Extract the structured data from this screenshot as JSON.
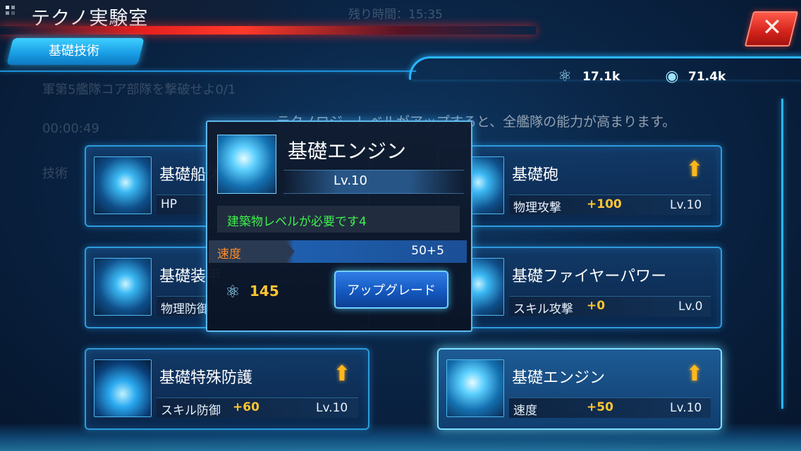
{
  "header": {
    "title": "テクノ実験室",
    "timer_ghost": "残り時間：15:35",
    "close_icon": "close-x-icon"
  },
  "tabs": [
    {
      "label": "基礎技術",
      "active": true
    }
  ],
  "resources": [
    {
      "icon": "atom-icon",
      "value": "17.1k"
    },
    {
      "icon": "robot-head-icon",
      "value": "71.4k"
    }
  ],
  "background_text": {
    "mission": "軍第5艦隊コア部隊を撃破せよ0/1",
    "mission_timer": "00:00:49",
    "tech_label": "技術",
    "info": "テクノロジーレベルがアップすると、全艦隊の能力が高まります。"
  },
  "cards": [
    {
      "name": "基礎船体",
      "stat": "HP",
      "bonus": "",
      "level": "",
      "upgradable": false
    },
    {
      "name": "基礎砲",
      "stat": "物理攻撃",
      "bonus": "+100",
      "level": "Lv.10",
      "upgradable": true
    },
    {
      "name": "基礎装甲",
      "stat": "物理防御",
      "bonus": "",
      "level": "",
      "upgradable": false
    },
    {
      "name": "基礎ファイヤーパワー",
      "stat": "スキル攻撃",
      "bonus": "+0",
      "level": "Lv.0",
      "upgradable": false
    },
    {
      "name": "基礎特殊防護",
      "stat": "スキル防御",
      "bonus": "+60",
      "level": "Lv.10",
      "upgradable": true
    },
    {
      "name": "基礎エンジン",
      "stat": "速度",
      "bonus": "+50",
      "level": "Lv.10",
      "upgradable": true,
      "selected": true
    }
  ],
  "popup": {
    "title": "基礎エンジン",
    "level": "Lv.10",
    "requirement": "建築物レベルが必要です4",
    "stat_name": "速度",
    "stat_value": "50+5",
    "cost": "145",
    "cost_icon": "atom-icon",
    "upgrade_label": "アップグレード"
  },
  "colors": {
    "accent": "#2ab6ff",
    "bonus": "#ffc531",
    "requirement": "#3cf24b",
    "stat_label": "#ff8c2a",
    "close": "#d3221a"
  }
}
